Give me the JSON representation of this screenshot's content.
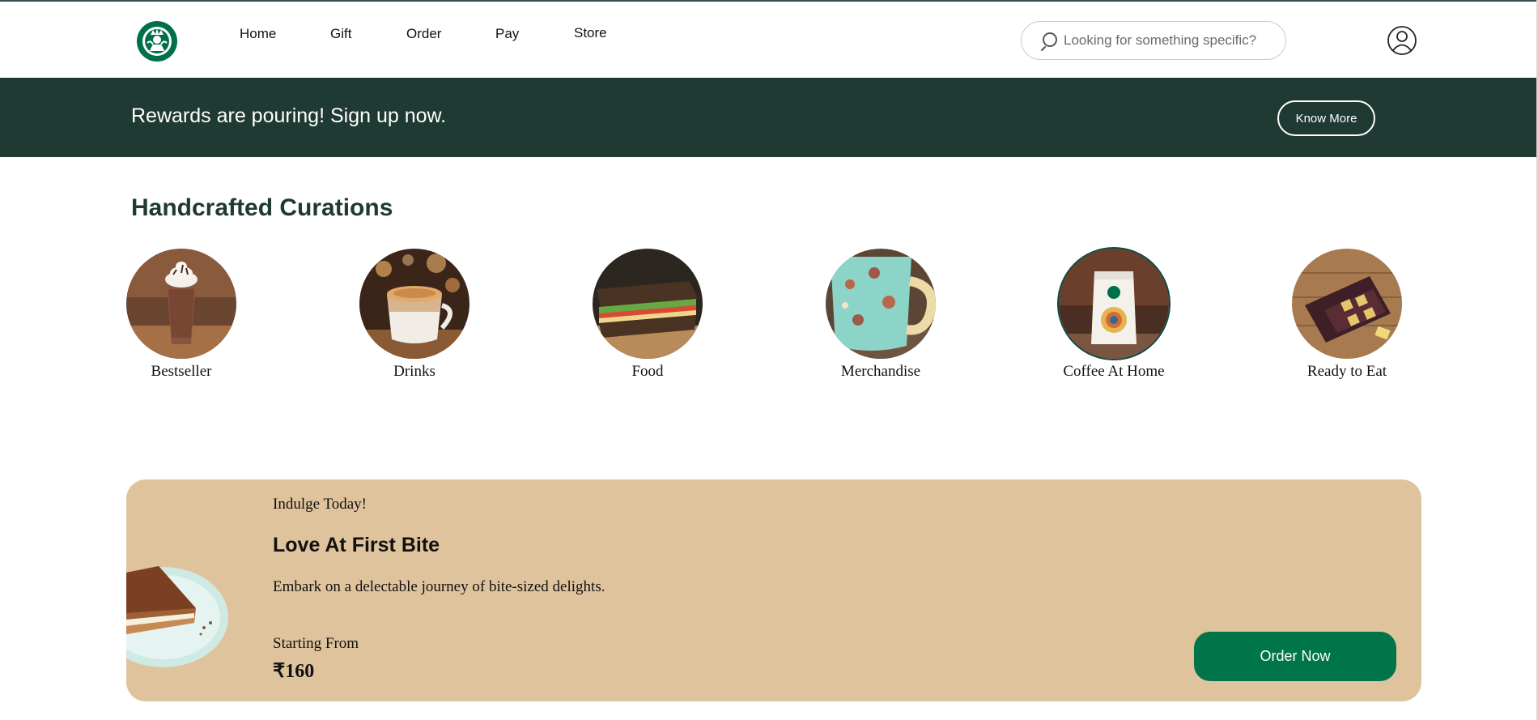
{
  "header": {
    "logo_icon": "starbucks-siren-logo",
    "nav": [
      {
        "label": "Home"
      },
      {
        "label": "Gift"
      },
      {
        "label": "Order"
      },
      {
        "label": "Pay"
      },
      {
        "label": "Store"
      }
    ],
    "search": {
      "placeholder": "Looking for something specific?",
      "value": "",
      "icon": "search-icon"
    },
    "account_icon": "user-account-icon"
  },
  "banner": {
    "text": "Rewards are pouring! Sign up now.",
    "button_label": "Know More",
    "background": "#1f3933"
  },
  "curations": {
    "title": "Handcrafted Curations",
    "items": [
      {
        "label": "Bestseller"
      },
      {
        "label": "Drinks"
      },
      {
        "label": "Food"
      },
      {
        "label": "Merchandise"
      },
      {
        "label": "Coffee At Home"
      },
      {
        "label": "Ready to Eat"
      }
    ]
  },
  "promo": {
    "kicker": "Indulge Today!",
    "headline": "Love At First Bite",
    "description": "Embark on a delectable journey of bite-sized delights.",
    "price_label": "Starting From",
    "price": "₹160",
    "button_label": "Order Now",
    "background": "#dfc39c",
    "button_color": "#00754a"
  }
}
